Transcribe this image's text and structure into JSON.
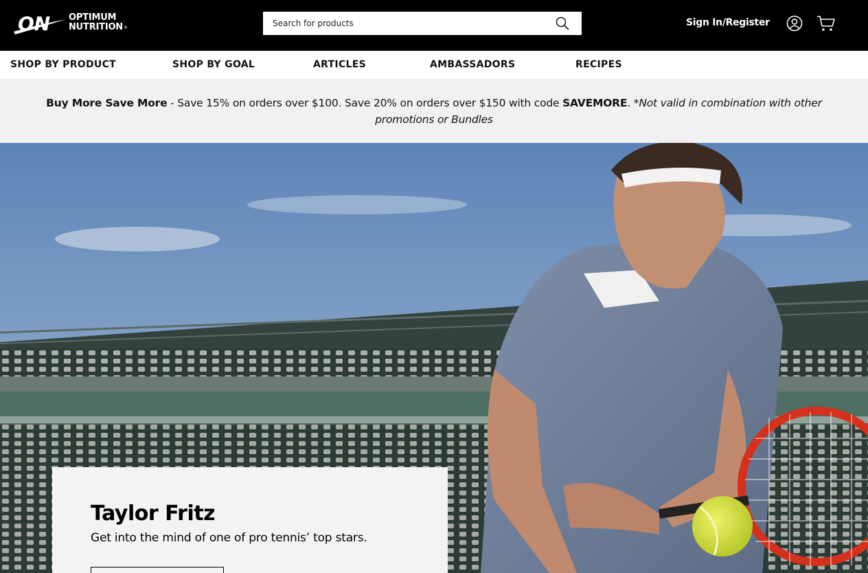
{
  "header": {
    "logo": {
      "line1": "OPTIMUM",
      "line2": "NUTRITION",
      "mark": "ON",
      "registered": "®"
    },
    "search": {
      "placeholder": "Search for products",
      "value": ""
    },
    "sign_in_label": "Sign In/Register",
    "icons": [
      "search-icon",
      "account-icon",
      "cart-icon"
    ]
  },
  "nav": {
    "items": [
      {
        "label": "SHOP BY PRODUCT"
      },
      {
        "label": "SHOP BY GOAL"
      },
      {
        "label": "ARTICLES"
      },
      {
        "label": "AMBASSADORS"
      },
      {
        "label": "RECIPES"
      }
    ]
  },
  "promo": {
    "headline": "Buy More Save More",
    "text": " - Save 15% on orders over $100. Save 20% on orders over $150 with code ",
    "code": "SAVEMORE",
    "period": ".",
    "disclaimer": " *Not valid in combination with other promotions or Bundles"
  },
  "hero": {
    "title": "Taylor Fritz",
    "subtitle": "Get into the mind of one of pro tennis’ top stars."
  },
  "colors": {
    "header_bg": "#000000",
    "promo_bg": "#f1f1f1",
    "card_bg": "#f3f3f3",
    "sky": "#7d9cc4",
    "racket": "#d4301c",
    "ball": "#d6e83a"
  }
}
